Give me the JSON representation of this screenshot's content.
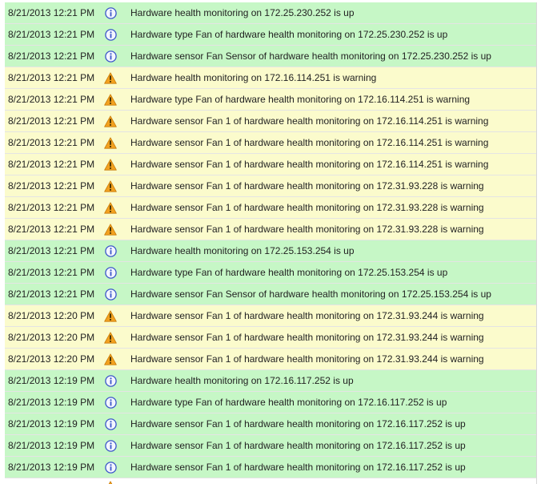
{
  "colors": {
    "info_row": "#c6f7c6",
    "warning_row": "#fbfbcc",
    "info_icon": "#3b55c9",
    "warning_icon": "#f2a11f"
  },
  "events": [
    {
      "time": "8/21/2013 12:21 PM",
      "severity": "info",
      "icon": "info-icon",
      "message": "Hardware health monitoring on 172.25.230.252 is up"
    },
    {
      "time": "8/21/2013 12:21 PM",
      "severity": "info",
      "icon": "info-icon",
      "message": "Hardware type Fan of hardware health monitoring on 172.25.230.252 is up"
    },
    {
      "time": "8/21/2013 12:21 PM",
      "severity": "info",
      "icon": "info-icon",
      "message": "Hardware sensor Fan Sensor of hardware health monitoring on 172.25.230.252 is up"
    },
    {
      "time": "8/21/2013 12:21 PM",
      "severity": "warning",
      "icon": "warning-icon",
      "message": "Hardware health monitoring on 172.16.114.251 is warning"
    },
    {
      "time": "8/21/2013 12:21 PM",
      "severity": "warning",
      "icon": "warning-icon",
      "message": "Hardware type Fan of hardware health monitoring on 172.16.114.251 is warning"
    },
    {
      "time": "8/21/2013 12:21 PM",
      "severity": "warning",
      "icon": "warning-icon",
      "message": "Hardware sensor Fan 1 of hardware health monitoring on 172.16.114.251 is warning"
    },
    {
      "time": "8/21/2013 12:21 PM",
      "severity": "warning",
      "icon": "warning-icon",
      "message": "Hardware sensor Fan 1 of hardware health monitoring on 172.16.114.251 is warning"
    },
    {
      "time": "8/21/2013 12:21 PM",
      "severity": "warning",
      "icon": "warning-icon",
      "message": "Hardware sensor Fan 1 of hardware health monitoring on 172.16.114.251 is warning"
    },
    {
      "time": "8/21/2013 12:21 PM",
      "severity": "warning",
      "icon": "warning-icon",
      "message": "Hardware sensor Fan 1 of hardware health monitoring on 172.31.93.228 is warning"
    },
    {
      "time": "8/21/2013 12:21 PM",
      "severity": "warning",
      "icon": "warning-icon",
      "message": "Hardware sensor Fan 1 of hardware health monitoring on 172.31.93.228 is warning"
    },
    {
      "time": "8/21/2013 12:21 PM",
      "severity": "warning",
      "icon": "warning-icon",
      "message": "Hardware sensor Fan 1 of hardware health monitoring on 172.31.93.228 is warning"
    },
    {
      "time": "8/21/2013 12:21 PM",
      "severity": "info",
      "icon": "info-icon",
      "message": "Hardware health monitoring on 172.25.153.254 is up"
    },
    {
      "time": "8/21/2013 12:21 PM",
      "severity": "info",
      "icon": "info-icon",
      "message": "Hardware type Fan of hardware health monitoring on 172.25.153.254 is up"
    },
    {
      "time": "8/21/2013 12:21 PM",
      "severity": "info",
      "icon": "info-icon",
      "message": "Hardware sensor Fan Sensor of hardware health monitoring on 172.25.153.254 is up"
    },
    {
      "time": "8/21/2013 12:20 PM",
      "severity": "warning",
      "icon": "warning-icon",
      "message": "Hardware sensor Fan 1 of hardware health monitoring on 172.31.93.244 is warning"
    },
    {
      "time": "8/21/2013 12:20 PM",
      "severity": "warning",
      "icon": "warning-icon",
      "message": "Hardware sensor Fan 1 of hardware health monitoring on 172.31.93.244 is warning"
    },
    {
      "time": "8/21/2013 12:20 PM",
      "severity": "warning",
      "icon": "warning-icon",
      "message": "Hardware sensor Fan 1 of hardware health monitoring on 172.31.93.244 is warning"
    },
    {
      "time": "8/21/2013 12:19 PM",
      "severity": "info",
      "icon": "info-icon",
      "message": "Hardware health monitoring on 172.16.117.252 is up"
    },
    {
      "time": "8/21/2013 12:19 PM",
      "severity": "info",
      "icon": "info-icon",
      "message": "Hardware type Fan of hardware health monitoring on 172.16.117.252 is up"
    },
    {
      "time": "8/21/2013 12:19 PM",
      "severity": "info",
      "icon": "info-icon",
      "message": "Hardware sensor Fan 1 of hardware health monitoring on 172.16.117.252 is up"
    },
    {
      "time": "8/21/2013 12:19 PM",
      "severity": "info",
      "icon": "info-icon",
      "message": "Hardware sensor Fan 1 of hardware health monitoring on 172.16.117.252 is up"
    },
    {
      "time": "8/21/2013 12:19 PM",
      "severity": "info",
      "icon": "info-icon",
      "message": "Hardware sensor Fan 1 of hardware health monitoring on 172.16.117.252 is up"
    }
  ],
  "partial_row": {
    "severity": "warning",
    "icon": "warning-icon"
  }
}
